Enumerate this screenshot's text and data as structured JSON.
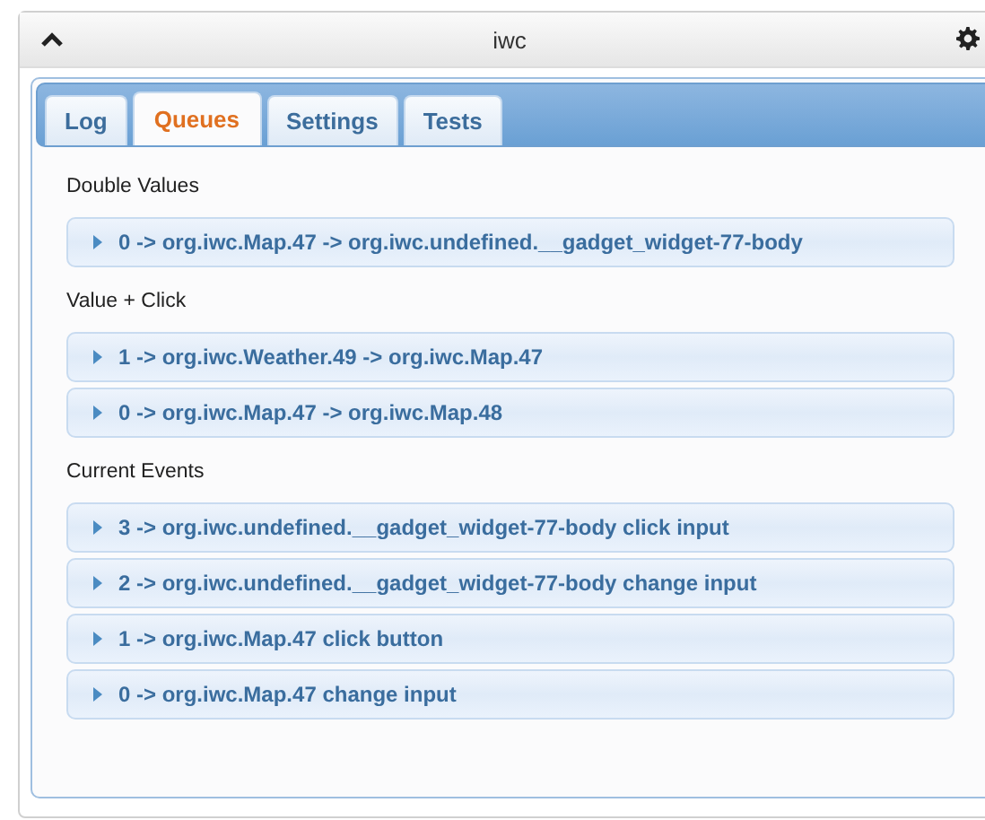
{
  "window": {
    "title": "iwc"
  },
  "tabs": [
    {
      "label": "Log",
      "selected": false
    },
    {
      "label": "Queues",
      "selected": true
    },
    {
      "label": "Settings",
      "selected": false
    },
    {
      "label": "Tests",
      "selected": false
    }
  ],
  "sections": [
    {
      "heading": "Double Values",
      "items": [
        {
          "text": "0 -> org.iwc.Map.47 -> org.iwc.undefined.__gadget_widget-77-body",
          "expanded": false
        }
      ]
    },
    {
      "heading": "Value + Click",
      "items": [
        {
          "text": "1 -> org.iwc.Weather.49 -> org.iwc.Map.47",
          "expanded": false
        },
        {
          "text": "0 -> org.iwc.Map.47 -> org.iwc.Map.48",
          "expanded": false
        }
      ]
    },
    {
      "heading": "Current Events",
      "items": [
        {
          "text": "3 -> org.iwc.undefined.__gadget_widget-77-body click input",
          "expanded": false
        },
        {
          "text": "2 -> org.iwc.undefined.__gadget_widget-77-body change input",
          "expanded": false
        },
        {
          "text": "1 -> org.iwc.Map.47 click button",
          "expanded": false
        },
        {
          "text": "0 -> org.iwc.Map.47 change input",
          "expanded": false
        }
      ]
    }
  ]
}
